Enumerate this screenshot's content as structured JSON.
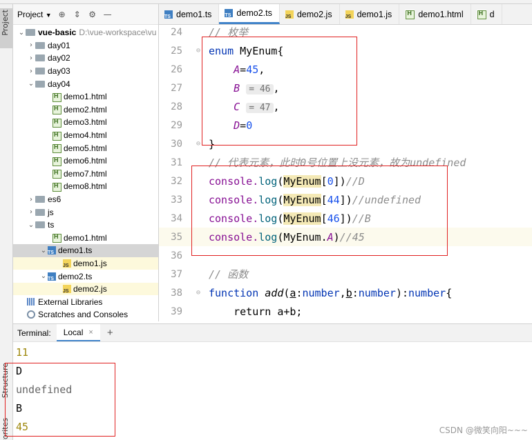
{
  "stripe": {
    "project_label": "Project",
    "structure_label": "Structure",
    "favorites_label": "vorites"
  },
  "project_panel": {
    "title": "Project",
    "root": {
      "name": "vue-basic",
      "path": "D:\\vue-workspace\\vu"
    },
    "folders": [
      "day01",
      "day02",
      "day03",
      "day04"
    ],
    "day04_files": [
      "demo1.html",
      "demo2.html",
      "demo3.html",
      "demo4.html",
      "demo5.html",
      "demo6.html",
      "demo7.html",
      "demo8.html"
    ],
    "folders2": [
      "es6",
      "js",
      "ts"
    ],
    "ts_children": {
      "html": "demo1.html",
      "demo1_ts": "demo1.ts",
      "demo1_js": "demo1.js",
      "demo2_ts": "demo2.ts",
      "demo2_js": "demo2.js"
    },
    "external_libraries": "External Libraries",
    "scratches": "Scratches and Consoles"
  },
  "tabs": [
    {
      "label": "demo1.ts",
      "type": "ts",
      "active": false
    },
    {
      "label": "demo2.ts",
      "type": "ts",
      "active": true
    },
    {
      "label": "demo2.js",
      "type": "js",
      "active": false
    },
    {
      "label": "demo1.js",
      "type": "js",
      "active": false
    },
    {
      "label": "demo1.html",
      "type": "html",
      "active": false
    },
    {
      "label": "d",
      "type": "html",
      "active": false
    }
  ],
  "editor": {
    "line_numbers": [
      "24",
      "25",
      "26",
      "27",
      "28",
      "29",
      "30",
      "31",
      "32",
      "33",
      "34",
      "35",
      "36",
      "37",
      "38",
      "39"
    ],
    "comment_24": "// 枚举",
    "enum_kw": "enum",
    "enum_name": "MyEnum{",
    "a_name": "A",
    "a_val": "45",
    "b_name": "B",
    "b_hint": "= 46",
    "c_name": "C",
    "c_hint": "= 47",
    "d_name": "D",
    "d_val": "0",
    "close_brace": "}",
    "comment_31": "// 代表元素，此时0号位置上没元素，故为undefined",
    "log_call": "console.",
    "log_fn": "log",
    "enum_ref": "MyEnum",
    "idx_0": "0",
    "idx_44": "44",
    "idx_46": "46",
    "cm_d": "//D",
    "cm_undefined": "//undefined",
    "cm_b": "//B",
    "cm_45": "//45",
    "prop_a": "A",
    "comment_37": "// 函数",
    "fn_kw": "function",
    "fn_name": "add",
    "param_a": "a",
    "param_b": "b",
    "type_number": "number",
    "return_line": "return a+b;"
  },
  "terminal": {
    "label": "Terminal:",
    "tab": "Local",
    "close": "×",
    "add": "+",
    "lines": [
      "11",
      "D",
      "undefined",
      "B",
      "45"
    ]
  },
  "watermark": "CSDN @微笑向阳~~~"
}
